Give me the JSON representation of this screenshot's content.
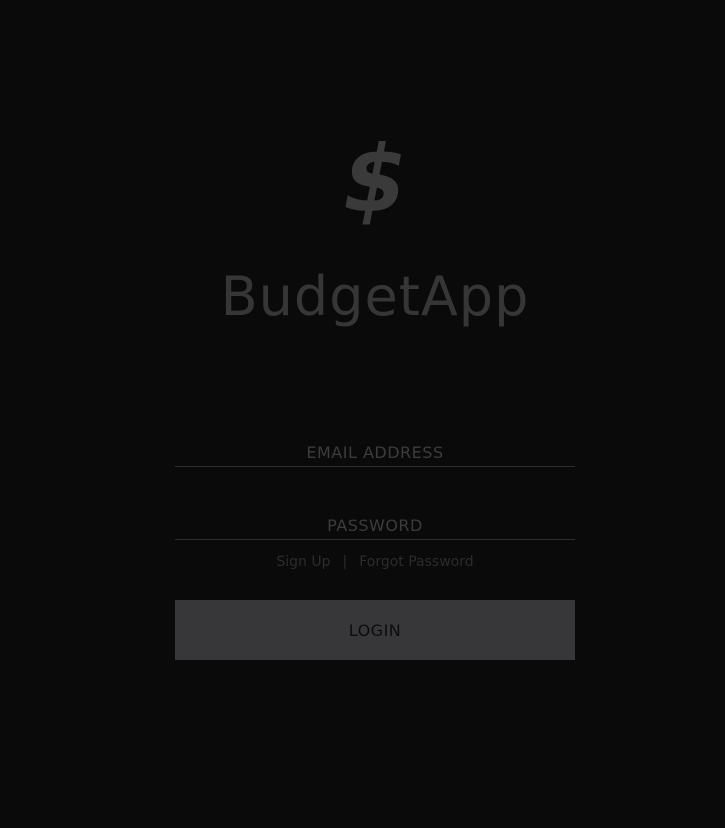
{
  "brand": {
    "logo_glyph": "$",
    "icon": "dollar-sign-icon",
    "title": "BudgetApp"
  },
  "form": {
    "email_placeholder": "EMAIL ADDRESS",
    "email_value": "",
    "password_placeholder": "PASSWORD",
    "password_value": ""
  },
  "links": {
    "sign_up": "Sign Up",
    "separator": "|",
    "forgot_password": "Forgot Password"
  },
  "actions": {
    "login_label": "LOGIN"
  },
  "colors": {
    "background": "#0a0a0b",
    "button": "#37373a",
    "muted_text": "#363637"
  }
}
